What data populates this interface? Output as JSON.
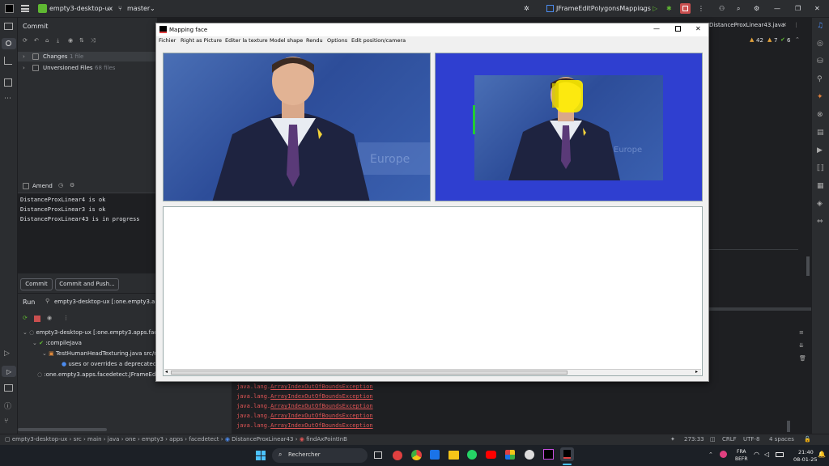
{
  "ide": {
    "project": "empty3-desktop-ux",
    "branch": "master",
    "run_config": "JFrameEditPolygonsMappings",
    "editor_tab": "DistanceProxLinear43.java",
    "inspections": {
      "warnings": "42",
      "weak_warnings": "7",
      "typos": "6"
    }
  },
  "commit": {
    "title": "Commit",
    "changes_label": "Changes",
    "changes_count": "1 file",
    "unversioned_label": "Unversioned Files",
    "unversioned_count": "68 files",
    "amend_label": "Amend",
    "messages": [
      "DistanceProxLinear4 is ok",
      "DistanceProxLinear3 is ok",
      "DistanceProxLinear43 is in progress"
    ],
    "commit_button": "Commit",
    "commit_push_button": "Commit and Push..."
  },
  "run": {
    "tab_run": "Run",
    "tab_config": "empty3-desktop-ux [:one.empty3.app",
    "tree": [
      {
        "text": "empty3-desktop-ux [:one.empty3.apps.fac",
        "indent": 0
      },
      {
        "text": ":compileJava",
        "indent": 1
      },
      {
        "text": "TestHumanHeadTexturing.java src/m",
        "indent": 2
      },
      {
        "text": "uses or overrides a deprecated A",
        "indent": 3
      },
      {
        "text": ":one.empty3.apps.facedetect.JFrameEd",
        "indent": 1
      }
    ]
  },
  "console": {
    "lines": [
      {
        "prefix": "java.lang.",
        "link": "ArrayIndexOutOfBoundsException"
      },
      {
        "prefix": "java.lang.",
        "link": "ArrayIndexOutOfBoundsException"
      },
      {
        "prefix": "java.lang.",
        "link": "ArrayIndexOutOfBoundsException"
      },
      {
        "prefix": "java.lang.",
        "link": "ArrayIndexOutOfBoundsException"
      },
      {
        "prefix": "java.lang.",
        "link": "ArrayIndexOutOfBoundsException"
      }
    ]
  },
  "statusbar": {
    "breadcrumb": [
      "empty3-desktop-ux",
      "src",
      "main",
      "java",
      "one",
      "empty3",
      "apps",
      "facedetect",
      "DistanceProxLinear43",
      "findAxPointInB"
    ],
    "position": "273:33",
    "line_sep": "CRLF",
    "encoding": "UTF-8",
    "indent": "4 spaces"
  },
  "dialog": {
    "title": "Mapping face",
    "menu": [
      "Fichier",
      "Right as Picture",
      "Editer la texture",
      "Model shape",
      "Rendu",
      "Options",
      "Edit position/camera"
    ]
  },
  "taskbar": {
    "search_placeholder": "Rechercher",
    "lang_top": "FRA",
    "lang_bottom": "BEFR",
    "time": "21:40",
    "date": "08-01-25"
  },
  "colors": {
    "ide_bg": "#1e1f22",
    "panel_bg": "#2b2d30",
    "accent": "#3574f0",
    "error": "#e05555",
    "picture_blue": "#2f3fd0",
    "marker_yellow": "#ffee00",
    "marker_green": "#22cc33"
  }
}
